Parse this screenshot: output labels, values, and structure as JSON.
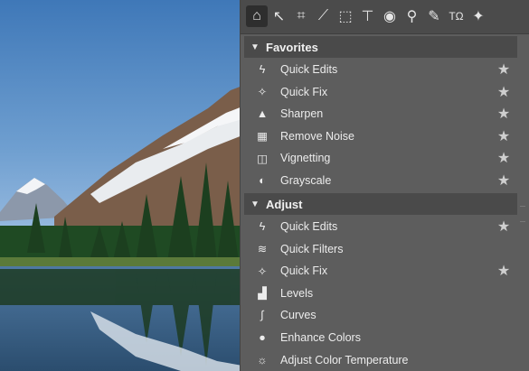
{
  "toolbar": {
    "tools": [
      {
        "name": "home-icon",
        "glyph": "⌂"
      },
      {
        "name": "pointer-icon",
        "glyph": "↖"
      },
      {
        "name": "crop-icon",
        "glyph": "⌗"
      },
      {
        "name": "perspective-icon",
        "glyph": "⟋"
      },
      {
        "name": "transform-icon",
        "glyph": "⬚"
      },
      {
        "name": "text-box-icon",
        "glyph": "⊤"
      },
      {
        "name": "eye-icon",
        "glyph": "◉"
      },
      {
        "name": "stamp-icon",
        "glyph": "⚲"
      },
      {
        "name": "brush-icon",
        "glyph": "✎"
      },
      {
        "name": "text-symbol-icon",
        "glyph": "TΩ"
      },
      {
        "name": "sparkle-icon",
        "glyph": "✦"
      }
    ]
  },
  "favorites": {
    "title": "Favorites",
    "items": [
      {
        "label": "Quick Edits",
        "icon": "lightning-icon",
        "glyph": "ϟ",
        "starred": true
      },
      {
        "label": "Quick Fix",
        "icon": "magic-wand-icon",
        "glyph": "✧",
        "starred": true
      },
      {
        "label": "Sharpen",
        "icon": "triangle-icon",
        "glyph": "▲",
        "starred": true
      },
      {
        "label": "Remove Noise",
        "icon": "noise-icon",
        "glyph": "▦",
        "starred": true
      },
      {
        "label": "Vignetting",
        "icon": "vignette-icon",
        "glyph": "◫",
        "starred": true
      },
      {
        "label": "Grayscale",
        "icon": "grayscale-icon",
        "glyph": "◐",
        "starred": true
      }
    ]
  },
  "adjust": {
    "title": "Adjust",
    "items": [
      {
        "label": "Quick Edits",
        "icon": "lightning-icon",
        "glyph": "ϟ",
        "starred": true
      },
      {
        "label": "Quick Filters",
        "icon": "filters-icon",
        "glyph": "≋",
        "starred": false
      },
      {
        "label": "Quick Fix",
        "icon": "magic-wand-icon",
        "glyph": "✧",
        "starred": true
      },
      {
        "label": "Levels",
        "icon": "levels-icon",
        "glyph": "▟",
        "starred": false
      },
      {
        "label": "Curves",
        "icon": "curves-icon",
        "glyph": "∫",
        "starred": false
      },
      {
        "label": "Enhance Colors",
        "icon": "palette-icon",
        "glyph": "●",
        "starred": false
      },
      {
        "label": "Adjust Color Temperature",
        "icon": "bulb-icon",
        "glyph": "☼",
        "starred": false
      }
    ]
  },
  "star_glyph": "★",
  "colors": {
    "panel": "#5d5d5d",
    "header": "#4a4a4a",
    "text": "#ececec",
    "sky": "#5b8fc7"
  }
}
